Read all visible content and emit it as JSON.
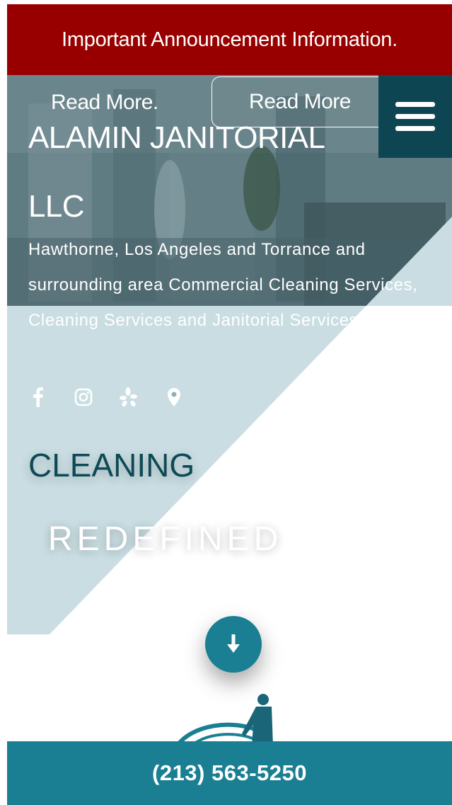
{
  "announcement": {
    "text": "Important Announcement Information."
  },
  "header": {
    "read_more_link": "Read More.",
    "read_more_button": "Read More",
    "menu_icon": "hamburger-menu-icon"
  },
  "hero": {
    "site_title_line1": "ALAMIN JANITORIAL",
    "site_title_line2": "LLC",
    "tagline": "Hawthorne, Los Angeles and Torrance and surrounding area Commercial Cleaning Services, Cleaning Services and Janitorial Services",
    "social_icons": [
      "facebook-icon",
      "instagram-icon",
      "yelp-icon",
      "map-pin-icon"
    ],
    "headline": "CLEANING",
    "subheadline": "REDEFINED",
    "scroll_icon": "arrow-down-icon"
  },
  "footer": {
    "phone": "(213) 563-5250"
  },
  "colors": {
    "announcement_bg": "#980000",
    "menu_bg": "#0d4652",
    "accent": "#1a7f93",
    "headline": "#0d4a56",
    "diagonal_panel": "#c9dde2"
  }
}
